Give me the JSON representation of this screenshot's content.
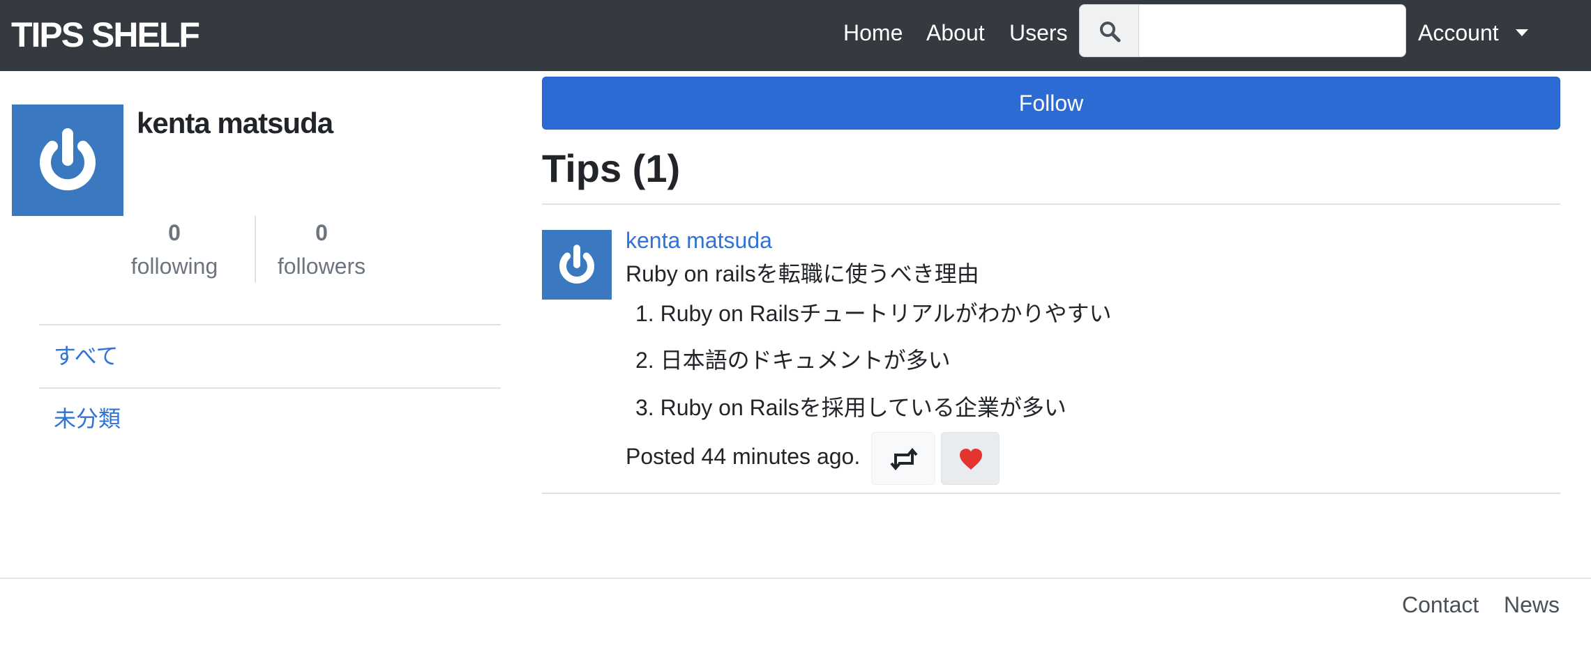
{
  "navbar": {
    "brand": "TIPS SHELF",
    "links": [
      "Home",
      "About",
      "Users"
    ],
    "search_value": "",
    "account_label": "Account",
    "background": "#343a40"
  },
  "profile": {
    "name": "kenta matsuda",
    "following_count": "0",
    "following_label": "following",
    "followers_count": "0",
    "followers_label": "followers"
  },
  "categories": [
    "すべて",
    "未分類"
  ],
  "main": {
    "follow_label": "Follow",
    "tips_heading": "Tips (1)",
    "tip": {
      "user": "kenta matsuda",
      "title": "Ruby on railsを転職に使うべき理由",
      "items": [
        "1. Ruby on Railsチュートリアルがわかりやすい",
        "2. 日本語のドキュメントが多い",
        "3. Ruby on Railsを採用している企業が多い"
      ],
      "posted": "Posted 44 minutes ago."
    }
  },
  "footer": {
    "links": [
      "Contact",
      "News"
    ]
  },
  "icons": {
    "search": "search-icon",
    "retweet": "retweet-icon",
    "like": "heart-icon",
    "avatar": "power-icon"
  },
  "colors": {
    "primary": "#2c6ad4",
    "link": "#2f73d6",
    "heart": "#e3342f",
    "avatar_bg": "#3a78bf"
  }
}
